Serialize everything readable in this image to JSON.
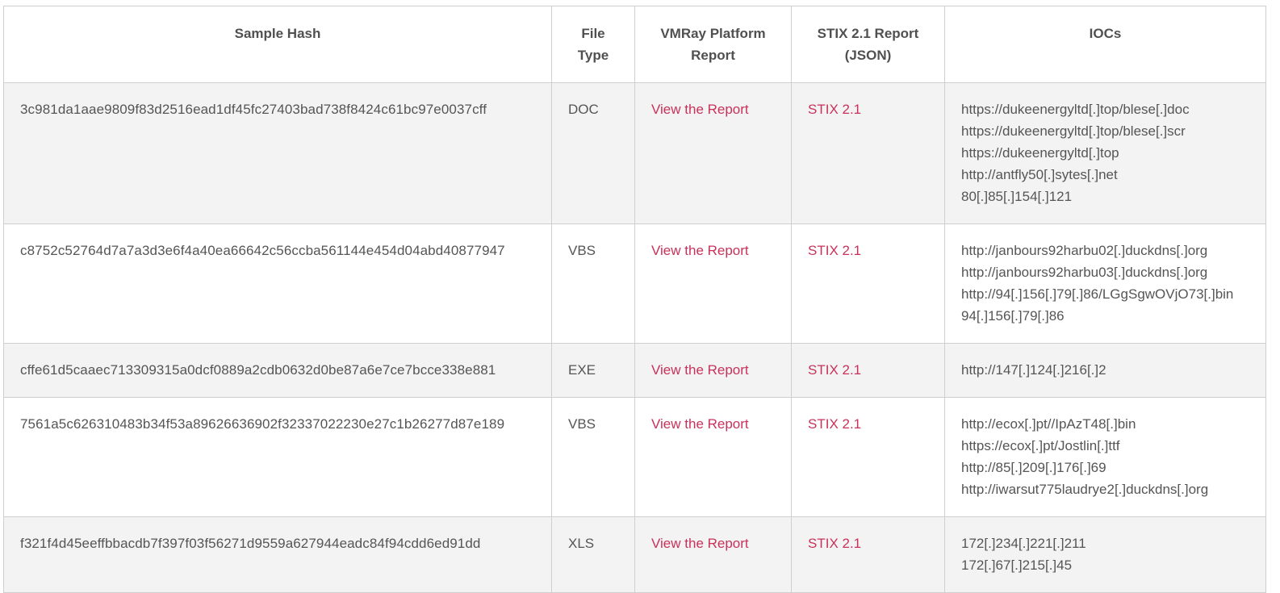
{
  "table": {
    "headers": {
      "hash": "Sample Hash",
      "type_line1": "File",
      "type_line2": "Type",
      "report_line1": "VMRay Platform",
      "report_line2": "Report",
      "stix_line1": "STIX 2.1 Report",
      "stix_line2": "(JSON)",
      "iocs": "IOCs"
    },
    "rows": [
      {
        "hash": "3c981da1aae9809f83d2516ead1df45fc27403bad738f8424c61bc97e0037cff",
        "type": "DOC",
        "report": "View the Report",
        "stix": "STIX 2.1",
        "iocs": [
          "https://dukeenergyltd[.]top/blese[.]doc",
          "https://dukeenergyltd[.]top/blese[.]scr",
          "https://dukeenergyltd[.]top",
          "http://antfly50[.]sytes[.]net",
          "80[.]85[.]154[.]121"
        ]
      },
      {
        "hash": "c8752c52764d7a7a3d3e6f4a40ea66642c56ccba561144e454d04abd40877947",
        "type": "VBS",
        "report": "View the Report",
        "stix": "STIX 2.1",
        "iocs": [
          "http://janbours92harbu02[.]duckdns[.]org",
          "http://janbours92harbu03[.]duckdns[.]org",
          "http://94[.]156[.]79[.]86/LGgSgwOVjO73[.]bin",
          "94[.]156[.]79[.]86"
        ]
      },
      {
        "hash": "cffe61d5caaec713309315a0dcf0889a2cdb0632d0be87a6e7ce7bcce338e881",
        "type": "EXE",
        "report": "View the Report",
        "stix": "STIX 2.1",
        "iocs": [
          "http://147[.]124[.]216[.]2"
        ]
      },
      {
        "hash": "7561a5c626310483b34f53a89626636902f32337022230e27c1b26277d87e189",
        "type": "VBS",
        "report": "View the Report",
        "stix": "STIX 2.1",
        "iocs": [
          "http://ecox[.]pt//IpAzT48[.]bin",
          "https://ecox[.]pt/Jostlin[.]ttf",
          "http://85[.]209[.]176[.]69",
          "http://iwarsut775laudrye2[.]duckdns[.]org"
        ]
      },
      {
        "hash": "f321f4d45eeffbbacdb7f397f03f56271d9559a627944eadc84f94cdd6ed91dd",
        "type": "XLS",
        "report": "View the Report",
        "stix": "STIX 2.1",
        "iocs": [
          "172[.]234[.]221[.]211",
          "172[.]67[.]215[.]45"
        ]
      }
    ]
  },
  "colors": {
    "link": "#c8325a",
    "shaded_row": "#f3f3f3",
    "border": "#cfcfcf",
    "text": "#555555"
  }
}
